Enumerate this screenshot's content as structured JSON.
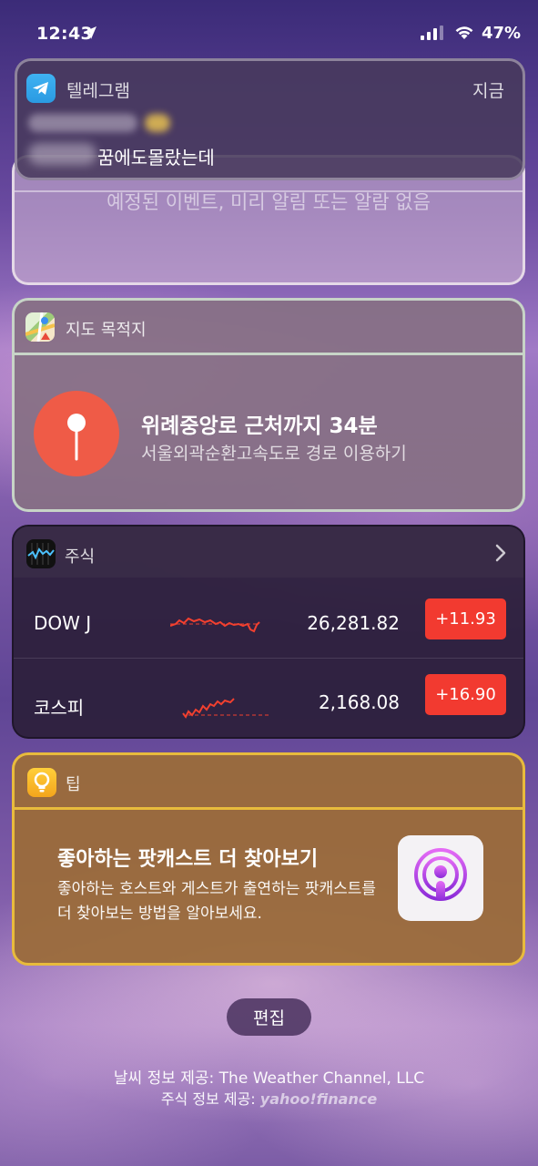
{
  "status_bar": {
    "time": "12:43",
    "battery": "47%"
  },
  "notification": {
    "app_name": "텔레그램",
    "time": "지금",
    "message": "꿈에도몰랐는데"
  },
  "calendar": {
    "text": "예정된 이벤트, 미리 알림 또는 알람 없음"
  },
  "maps": {
    "title": "지도 목적지",
    "route_title": "위례중앙로 근처까지 34분",
    "route_sub": "서울외곽순환고속도로 경로 이용하기"
  },
  "stocks": {
    "title": "주식",
    "rows": [
      {
        "name": "DOW J",
        "price": "26,281.82",
        "change": "+11.93"
      },
      {
        "name": "코스피",
        "price": "2,168.08",
        "change": "+16.90"
      }
    ],
    "change_color": "#f23a30"
  },
  "tips": {
    "title": "팁",
    "heading": "좋아하는 팟캐스트 더 찾아보기",
    "body": "좋아하는 호스트와 게스트가 출연하는 팟캐스트를 더 찾아보는 방법을 알아보세요."
  },
  "edit_label": "편집",
  "footer": {
    "weather_credit": "날씨 정보 제공: The Weather Channel, LLC",
    "stocks_credit_prefix": "주식 정보 제공: ",
    "stocks_credit_logo": "yahoo!finance"
  },
  "icons": {
    "location": "location-arrow-icon",
    "signal": "cellular-signal-icon",
    "wifi": "wifi-icon",
    "telegram": "telegram-icon",
    "maps": "maps-icon",
    "pin": "map-pin-icon",
    "stocks": "stocks-icon",
    "chevron": "chevron-right-icon",
    "tips": "lightbulb-icon",
    "podcast": "podcasts-icon"
  }
}
